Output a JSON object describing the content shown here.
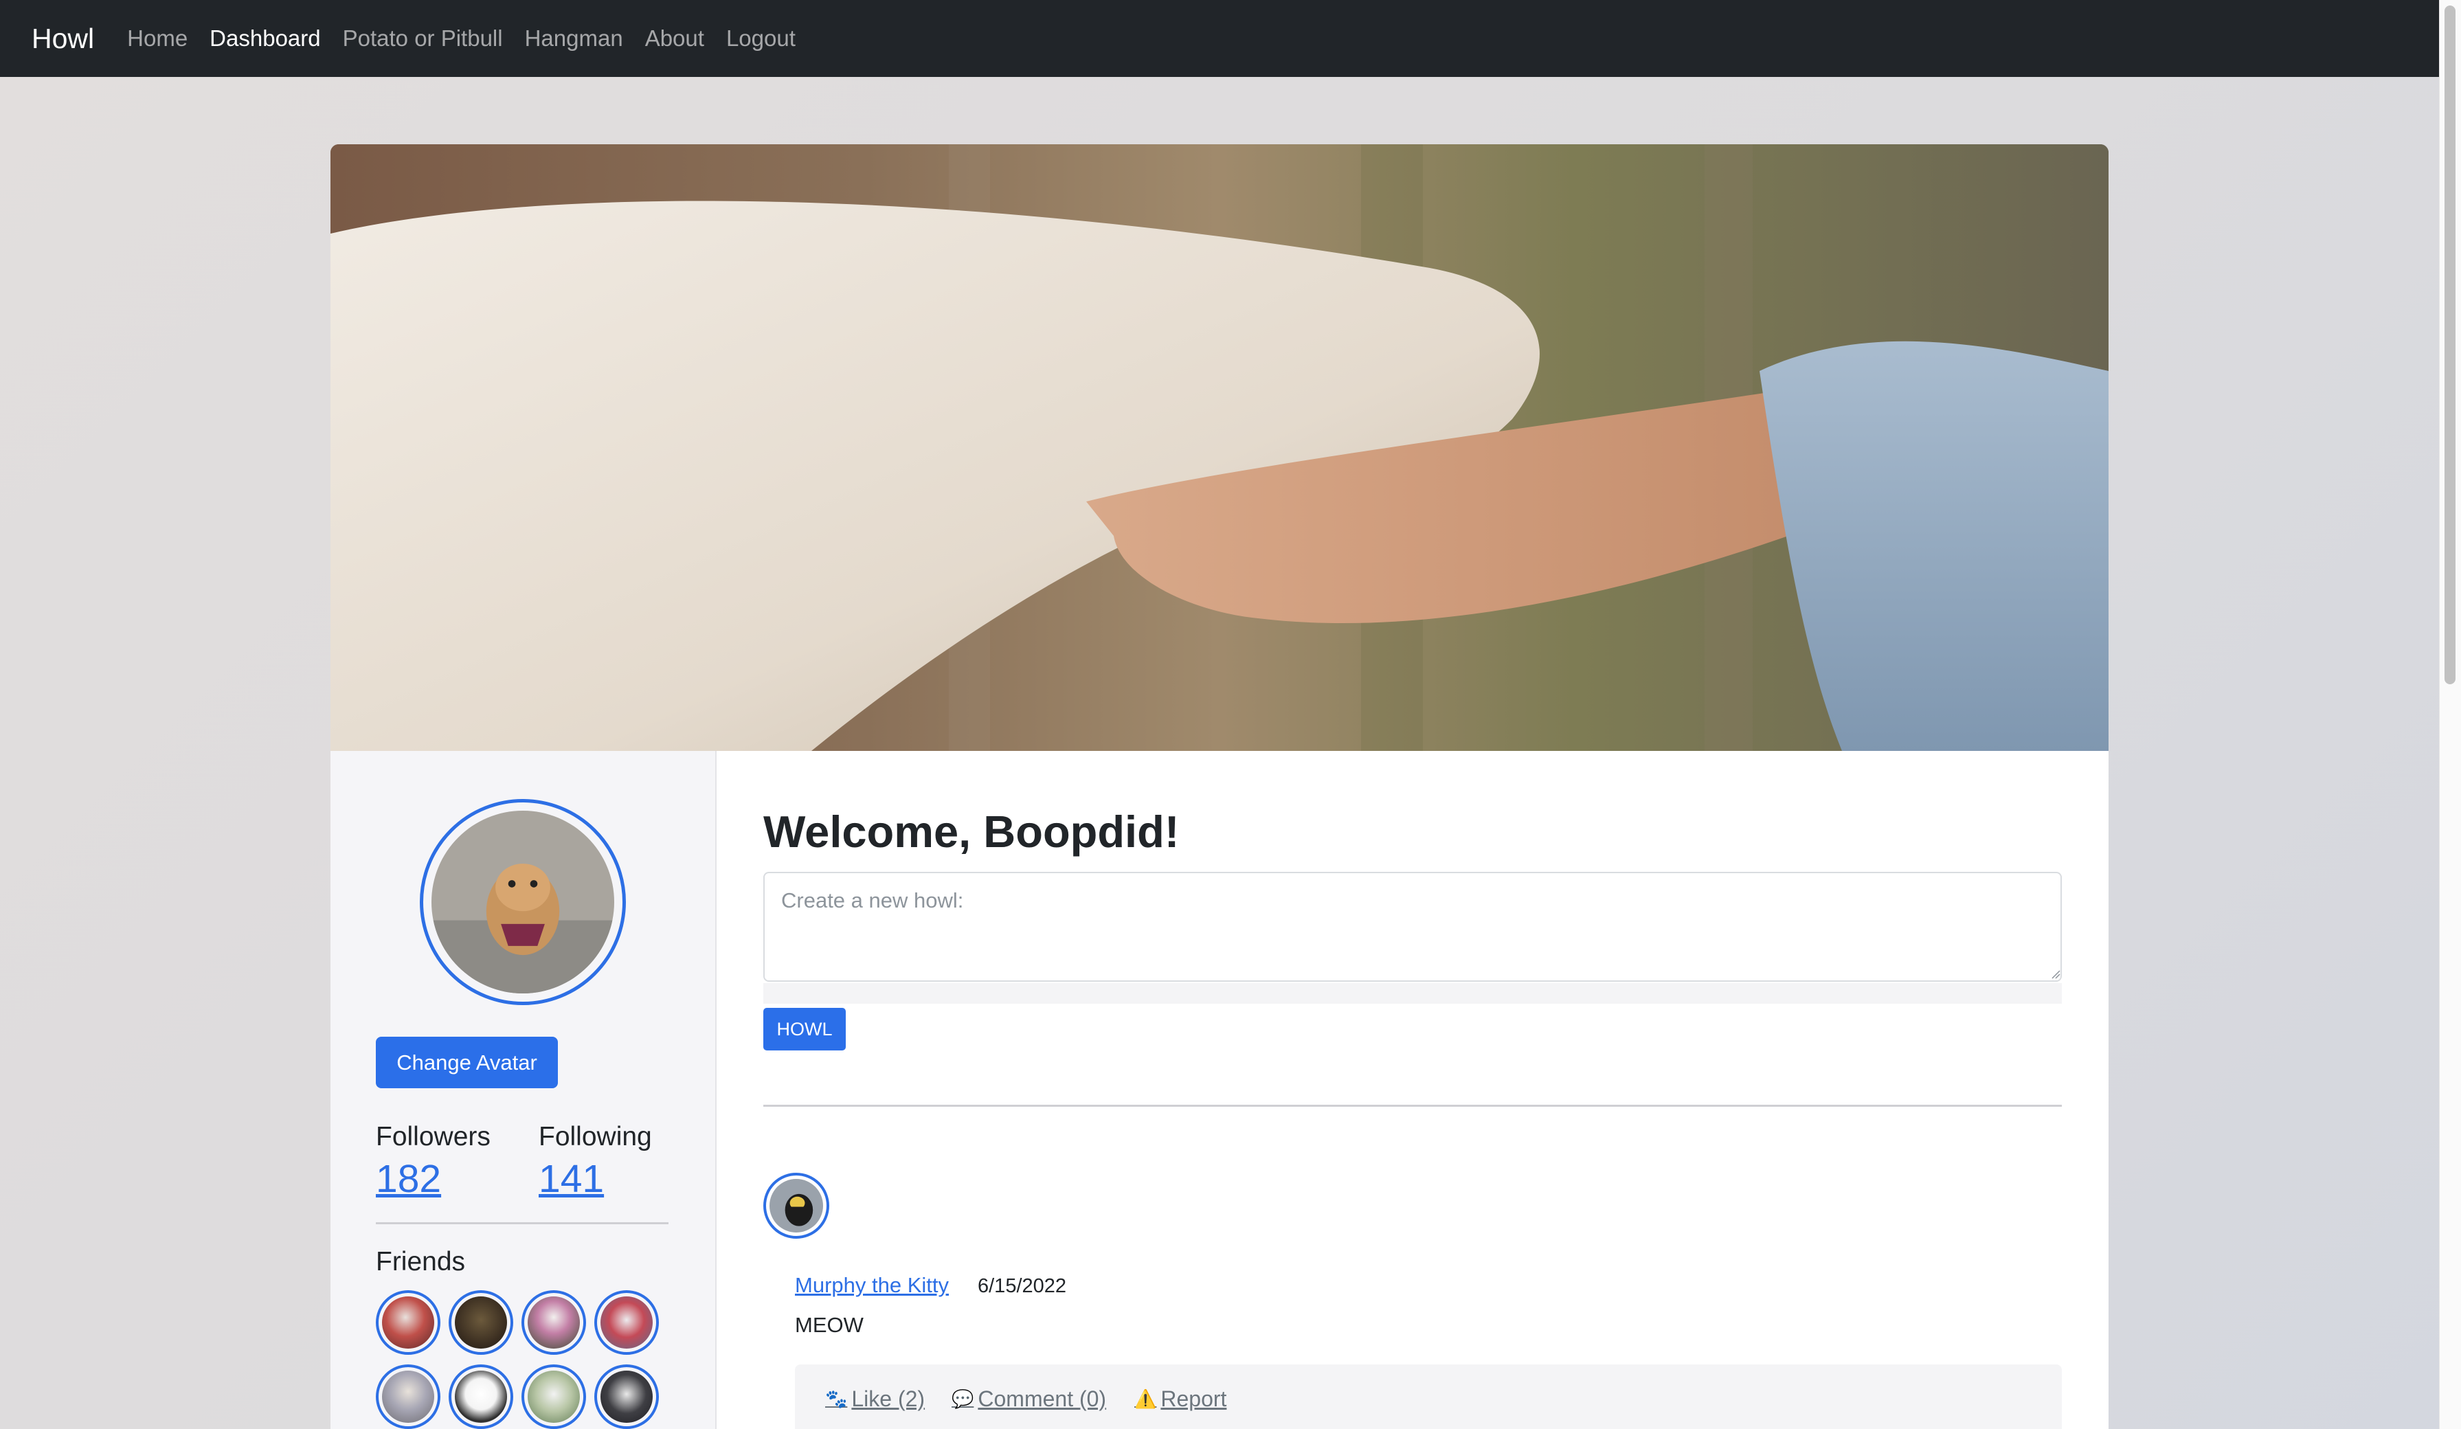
{
  "navbar": {
    "brand": "Howl",
    "links": [
      {
        "label": "Home",
        "active": false
      },
      {
        "label": "Dashboard",
        "active": true
      },
      {
        "label": "Potato or Pitbull",
        "active": false
      },
      {
        "label": "Hangman",
        "active": false
      },
      {
        "label": "About",
        "active": false
      },
      {
        "label": "Logout",
        "active": false
      }
    ]
  },
  "hero": {
    "icon": "dog-paw-in-hand-photo"
  },
  "profile": {
    "avatar_icon": "dog-avatar-photo",
    "change_avatar_label": "Change Avatar",
    "followers_label": "Followers",
    "followers_count": "182",
    "following_label": "Following",
    "following_count": "141",
    "friends_title": "Friends",
    "friends_count_visible": 8
  },
  "main": {
    "welcome": "Welcome, Boopdid!",
    "howl_placeholder": "Create a new howl:",
    "howl_value": "",
    "howl_button": "HOWL"
  },
  "post": {
    "author": "Murphy the Kitty",
    "date": "6/15/2022",
    "text": "MEOW",
    "like_label": "Like (2)",
    "comment_label": "Comment (0)",
    "report_label": "Report",
    "like_icon": "paw-icon",
    "comment_icon": "speech-bubble-icon",
    "report_icon": "warning-icon"
  },
  "colors": {
    "primary": "#2b6fe9",
    "navbar": "#212529",
    "link": "#2d6fe5"
  }
}
